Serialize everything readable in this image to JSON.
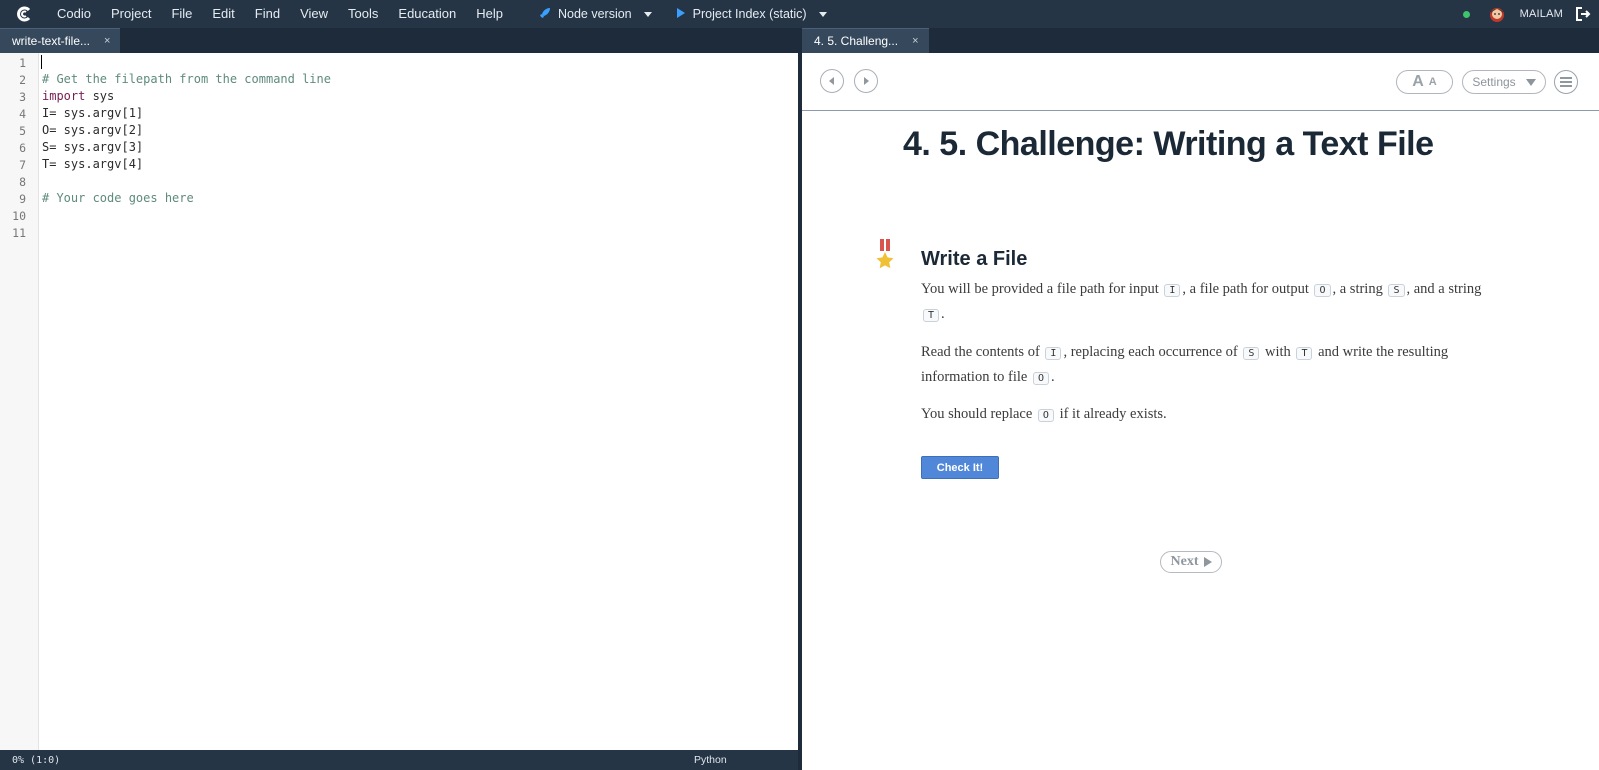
{
  "menubar": {
    "items": [
      "Codio",
      "Project",
      "File",
      "Edit",
      "Find",
      "View",
      "Tools",
      "Education",
      "Help"
    ],
    "run_node": "Node version",
    "run_project": "Project Index (static)",
    "username": "MAILAM"
  },
  "editor": {
    "tab_label": "write-text-file...",
    "close_glyph": "×",
    "line_numbers": [
      "1",
      "2",
      "3",
      "4",
      "5",
      "6",
      "7",
      "8",
      "9",
      "10",
      "11"
    ],
    "lines": {
      "l2": "# Get the filepath from the command line",
      "l3_kw": "import",
      "l3_rest": " sys",
      "l4": "I= sys.argv[1]",
      "l5": "O= sys.argv[2]",
      "l6": "S= sys.argv[3]",
      "l7": "T= sys.argv[4]",
      "l9": "# Your code goes here"
    },
    "status": {
      "position": "0% (1:0)",
      "language": "Python"
    }
  },
  "guide": {
    "tab_label": "4. 5. Challeng...",
    "close_glyph": "×",
    "font_big": "A",
    "font_small": "A",
    "settings_label": "Settings",
    "title": "4. 5. Challenge: Writing a Text File",
    "section_title": "Write a File",
    "p1": {
      "t1": "You will be provided a file path for input",
      "c1": "I",
      "t2": ", a file path for output",
      "c2": "O",
      "t3": ", a string",
      "c3": "S",
      "t4": ", and a string",
      "c4": "T",
      "t5": "."
    },
    "p2": {
      "t1": "Read the contents of",
      "c1": "I",
      "t2": ", replacing each occurrence of",
      "c2": "S",
      "t3": "with",
      "c3": "T",
      "t4": "and write the resulting information to file",
      "c4": "O",
      "t5": "."
    },
    "p3": {
      "t1": "You should replace",
      "c1": "O",
      "t2": "if it already exists."
    },
    "check_button": "Check It!",
    "next_button": "Next"
  },
  "colors": {
    "menubar_bg": "#253546",
    "accent_button": "#5187d8",
    "status_online": "#3ec46d"
  }
}
